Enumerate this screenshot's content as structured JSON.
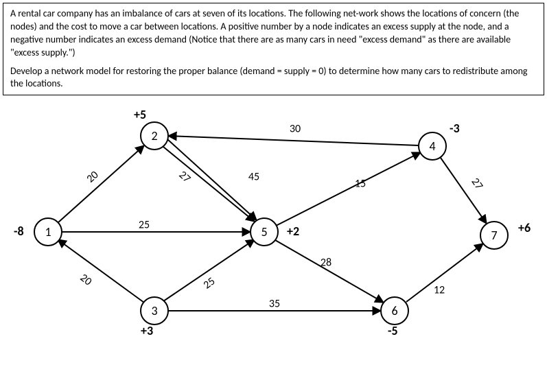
{
  "problem": {
    "p1": "A rental car company has an imbalance of cars at seven of its locations. The following net-work shows the locations of concern (the nodes) and the cost to move a car between locations. A positive number by a node indicates an excess supply at the node, and a negative number indicates an excess demand (Notice that there are as many cars in need \"excess demand\" as there are available \"excess supply.\")",
    "p2": "Develop a network model for restoring the proper balance (demand = supply = 0) to determine how many cars to redistribute among the locations."
  },
  "nodes": {
    "n1": "1",
    "n2": "2",
    "n3": "3",
    "n4": "4",
    "n5": "5",
    "n6": "6",
    "n7": "7"
  },
  "supply": {
    "n1": "-8",
    "n2": "+5",
    "n3": "+3",
    "n4": "-3",
    "n5": "+2",
    "n6": "-5",
    "n7": "+6"
  },
  "edges": {
    "e12": "20",
    "e13": "20",
    "e15": "25",
    "e25": "27",
    "e24": "30",
    "e35": "25",
    "e36": "35",
    "e54": "15",
    "e56": "28",
    "e52": "45",
    "e47": "27",
    "e67": "12"
  },
  "chart_data": {
    "type": "network",
    "title": "Rental car transshipment network",
    "nodes": [
      {
        "id": 1,
        "supply": -8
      },
      {
        "id": 2,
        "supply": 5
      },
      {
        "id": 3,
        "supply": 3
      },
      {
        "id": 4,
        "supply": -3
      },
      {
        "id": 5,
        "supply": 2
      },
      {
        "id": 6,
        "supply": -5
      },
      {
        "id": 7,
        "supply": 6
      }
    ],
    "edges": [
      {
        "from": 1,
        "to": 2,
        "cost": 20
      },
      {
        "from": 1,
        "to": 3,
        "cost": 20
      },
      {
        "from": 1,
        "to": 5,
        "cost": 25
      },
      {
        "from": 2,
        "to": 5,
        "cost": 27
      },
      {
        "from": 2,
        "to": 4,
        "cost": 30
      },
      {
        "from": 3,
        "to": 5,
        "cost": 25
      },
      {
        "from": 3,
        "to": 6,
        "cost": 35
      },
      {
        "from": 5,
        "to": 4,
        "cost": 15
      },
      {
        "from": 5,
        "to": 6,
        "cost": 28
      },
      {
        "from": 5,
        "to": 2,
        "cost": 45
      },
      {
        "from": 4,
        "to": 7,
        "cost": 27
      },
      {
        "from": 6,
        "to": 7,
        "cost": 12
      }
    ]
  }
}
